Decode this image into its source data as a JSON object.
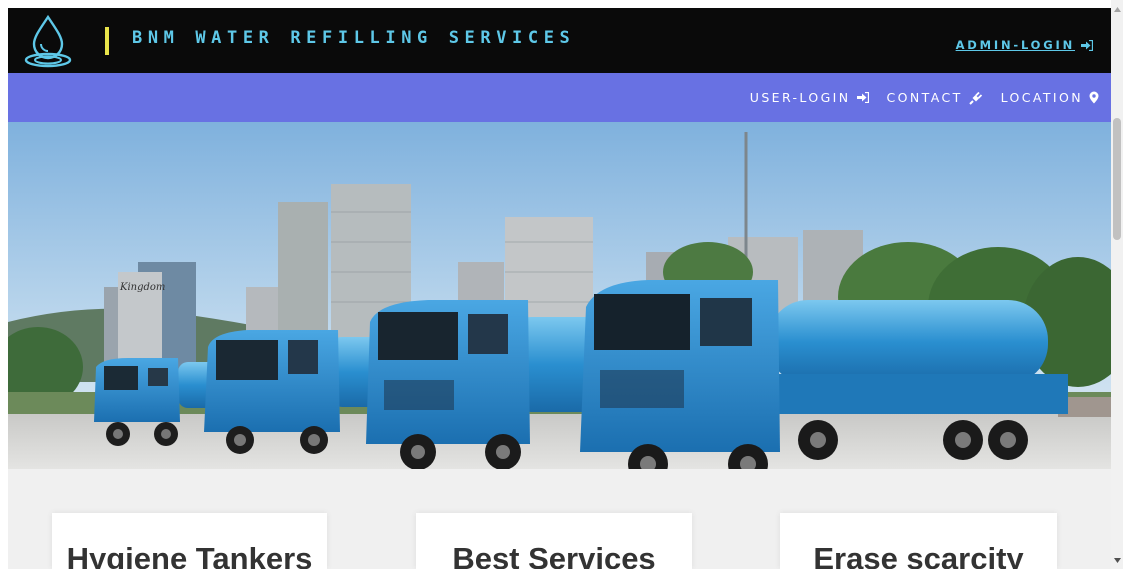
{
  "header": {
    "brand": "BNM WATER REFILLING SERVICES",
    "admin_login": "ADMIN-LOGIN",
    "logo_icon": "water-drop-icon",
    "accent_color": "#5ec8e8",
    "divider_color": "#e8e34a"
  },
  "nav": {
    "bar_color": "#6871e3",
    "items": [
      {
        "label": "USER-LOGIN",
        "icon": "sign-in-icon"
      },
      {
        "label": "CONTACT",
        "icon": "plug-icon"
      },
      {
        "label": "LOCATION",
        "icon": "map-marker-icon"
      }
    ]
  },
  "hero": {
    "image": "blue-water-tanker-trucks-city-skyline",
    "sign_text": "Kingdom"
  },
  "features": [
    {
      "title": "Hygiene Tankers"
    },
    {
      "title": "Best Services"
    },
    {
      "title": "Erase scarcity"
    }
  ]
}
